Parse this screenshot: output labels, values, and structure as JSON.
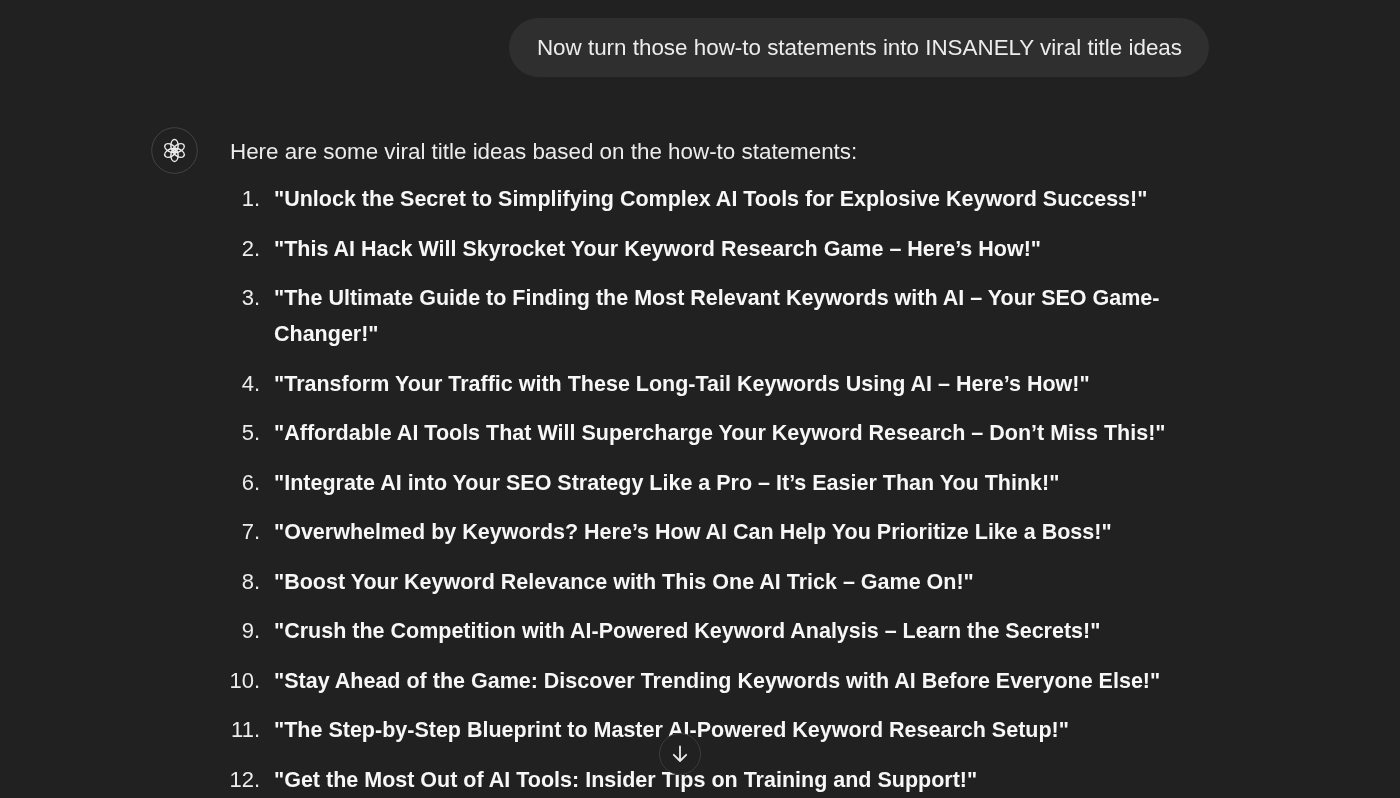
{
  "user_message": {
    "text": "Now turn those how-to statements into INSANELY viral title ideas"
  },
  "assistant_message": {
    "intro": "Here are some viral title ideas based on the how-to statements:",
    "items": [
      {
        "number": "1.",
        "text": "\"Unlock the Secret to Simplifying Complex AI Tools for Explosive Keyword Success!\""
      },
      {
        "number": "2.",
        "text": "\"This AI Hack Will Skyrocket Your Keyword Research Game – Here’s How!\""
      },
      {
        "number": "3.",
        "text": "\"The Ultimate Guide to Finding the Most Relevant Keywords with AI – Your SEO Game-Changer!\""
      },
      {
        "number": "4.",
        "text": "\"Transform Your Traffic with These Long-Tail Keywords Using AI – Here’s How!\""
      },
      {
        "number": "5.",
        "text": "\"Affordable AI Tools That Will Supercharge Your Keyword Research – Don’t Miss This!\""
      },
      {
        "number": "6.",
        "text": "\"Integrate AI into Your SEO Strategy Like a Pro – It’s Easier Than You Think!\""
      },
      {
        "number": "7.",
        "text": "\"Overwhelmed by Keywords? Here’s How AI Can Help You Prioritize Like a Boss!\""
      },
      {
        "number": "8.",
        "text": "\"Boost Your Keyword Relevance with This One AI Trick – Game On!\""
      },
      {
        "number": "9.",
        "text": "\"Crush the Competition with AI-Powered Keyword Analysis – Learn the Secrets!\""
      },
      {
        "number": "10.",
        "text": "\"Stay Ahead of the Game: Discover Trending Keywords with AI Before Everyone Else!\""
      },
      {
        "number": "11.",
        "text": "\"The Step-by-Step Blueprint to Master AI-Powered Keyword Research Setup!\""
      },
      {
        "number": "12.",
        "text": "\"Get the Most Out of AI Tools: Insider Tips on Training and Support!\""
      }
    ]
  }
}
